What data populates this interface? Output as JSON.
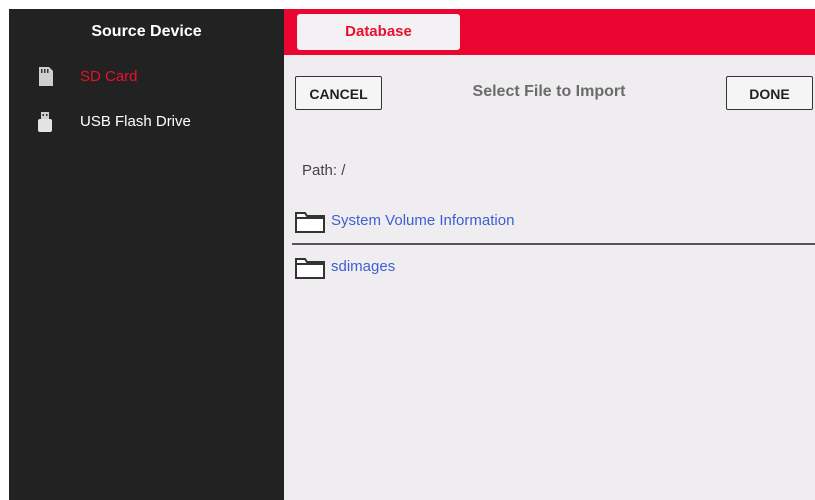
{
  "sidebar": {
    "title": "Source Device",
    "items": [
      {
        "label": "SD Card",
        "icon": "sd-card-icon",
        "active": true
      },
      {
        "label": "USB Flash Drive",
        "icon": "usb-drive-icon",
        "active": false
      }
    ]
  },
  "header": {
    "tab_label": "Database"
  },
  "dialog": {
    "cancel_label": "CANCEL",
    "title": "Select File to Import",
    "done_label": "DONE",
    "path_text": "Path: /",
    "entries": [
      {
        "name": "System Volume Information",
        "icon": "folder-icon"
      },
      {
        "name": "sdimages",
        "icon": "folder-icon"
      }
    ]
  },
  "colors": {
    "accent": "#eb0631",
    "sidebar_bg": "#222222",
    "link": "#3e5fd2",
    "panel_bg": "#efedef"
  }
}
